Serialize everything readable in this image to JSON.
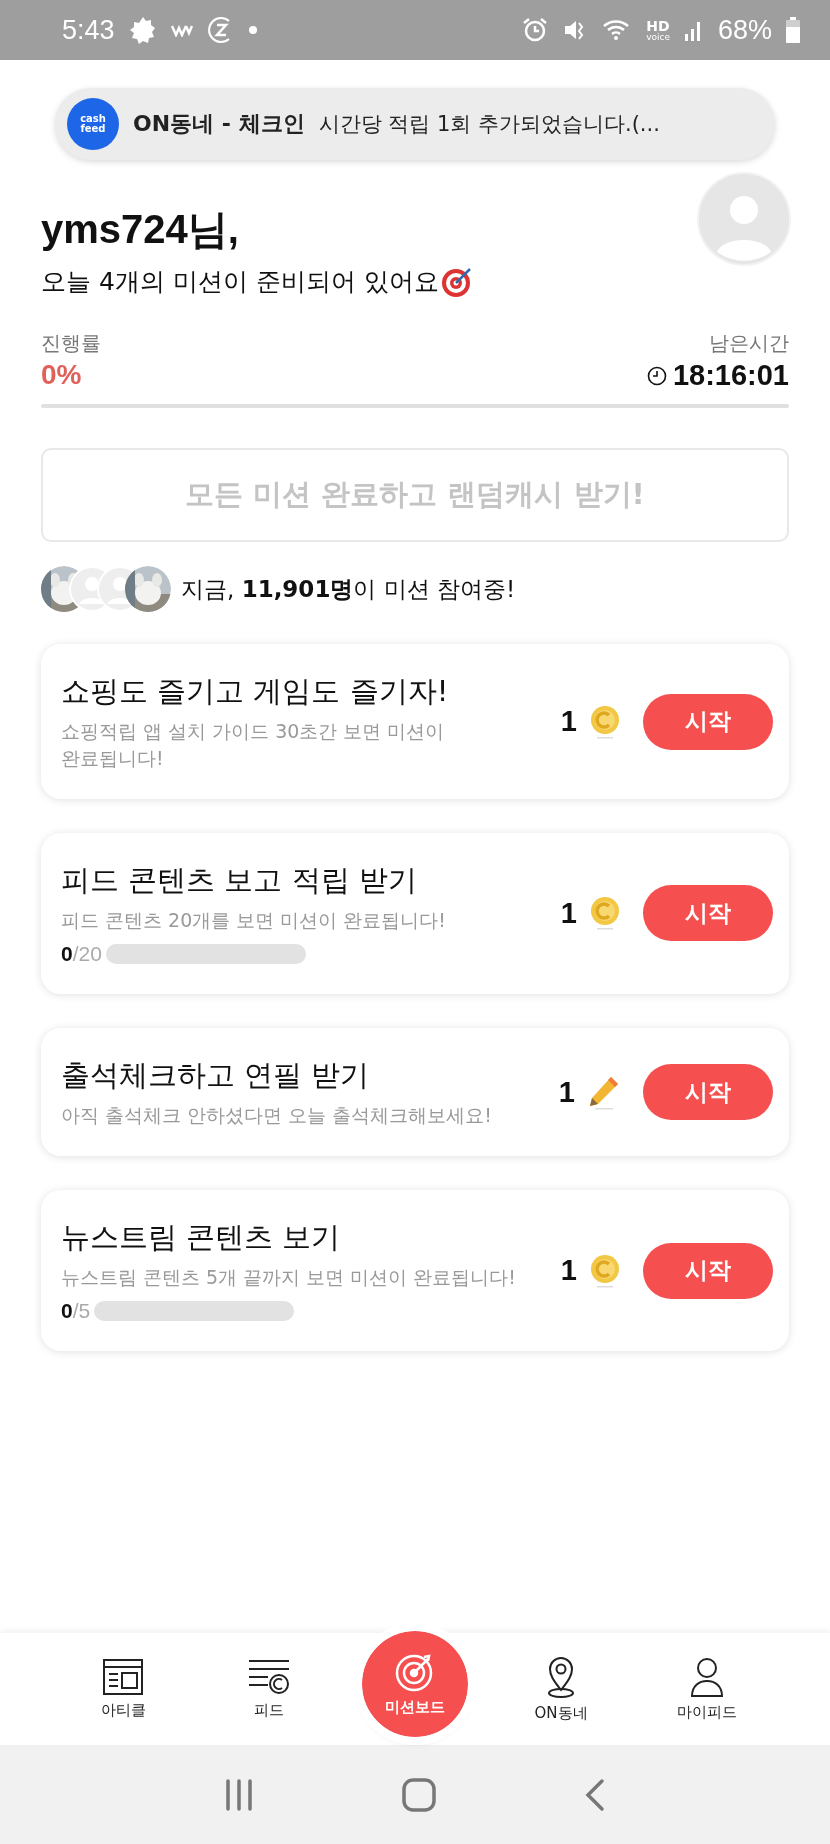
{
  "status_bar": {
    "time": "5:43",
    "hd_label": "HD",
    "hd_sub": "voice",
    "battery": "68%"
  },
  "toast": {
    "logo_lines": [
      "cash",
      "feed"
    ],
    "title": "ON동네 - 체크인",
    "message": "시간당 적립 1회 추가되었습니다.(..."
  },
  "greeting": {
    "name": "yms724님,",
    "subtitle": "오늘 4개의 미션이 준비되어 있어요"
  },
  "progress": {
    "label": "진행률",
    "value": "0%",
    "level": 0
  },
  "remaining": {
    "label": "남은시간",
    "time": "18:16:01"
  },
  "reward_button": {
    "label": "모든 미션 완료하고 랜덤캐시 받기!",
    "disabled": true
  },
  "participants": {
    "avatars": [
      {
        "kind": "picture"
      },
      {
        "kind": "placeholder"
      },
      {
        "kind": "placeholder"
      },
      {
        "kind": "picture"
      }
    ],
    "text": "지금, **11,901명**이 미션 참여중!"
  },
  "missions": [
    {
      "title": "쇼핑도 즐기고 게임도 즐기자!",
      "description": "쇼핑적립 앱 설치 가이드 30초간 보면 미션이 완료됩니다!",
      "reward": "1",
      "kind": "coin",
      "button": "시작"
    },
    {
      "title": "피드 콘텐츠 보고 적립 받기",
      "description": "피드 콘텐츠 20개를 보면 미션이 완료됩니다!",
      "reward": "1",
      "kind": "coin",
      "button": "시작",
      "progress": {
        "done": "0",
        "total": "/20",
        "level": 0
      }
    },
    {
      "title": "출석체크하고 연필 받기",
      "description": "아직 출석체크 안하셨다면 오늘 출석체크해보세요!",
      "reward": "1",
      "kind": "pencil",
      "button": "시작"
    },
    {
      "title": "뉴스트림 콘텐츠 보기",
      "description": "뉴스트림 콘텐츠 5개 끝까지 보면 미션이 완료됩니다!",
      "reward": "1",
      "kind": "coin",
      "button": "시작",
      "progress": {
        "done": "0",
        "total": "/5",
        "level": 0
      }
    }
  ],
  "bottom_nav": [
    {
      "label": "아티클",
      "kind": "article",
      "selected": false
    },
    {
      "label": "피드",
      "kind": "feed",
      "selected": false
    },
    {
      "label": "미션보드",
      "kind": "target",
      "selected": true
    },
    {
      "label": "ON동네",
      "kind": "pin",
      "selected": false
    },
    {
      "label": "마이피드",
      "kind": "person",
      "selected": false
    }
  ]
}
